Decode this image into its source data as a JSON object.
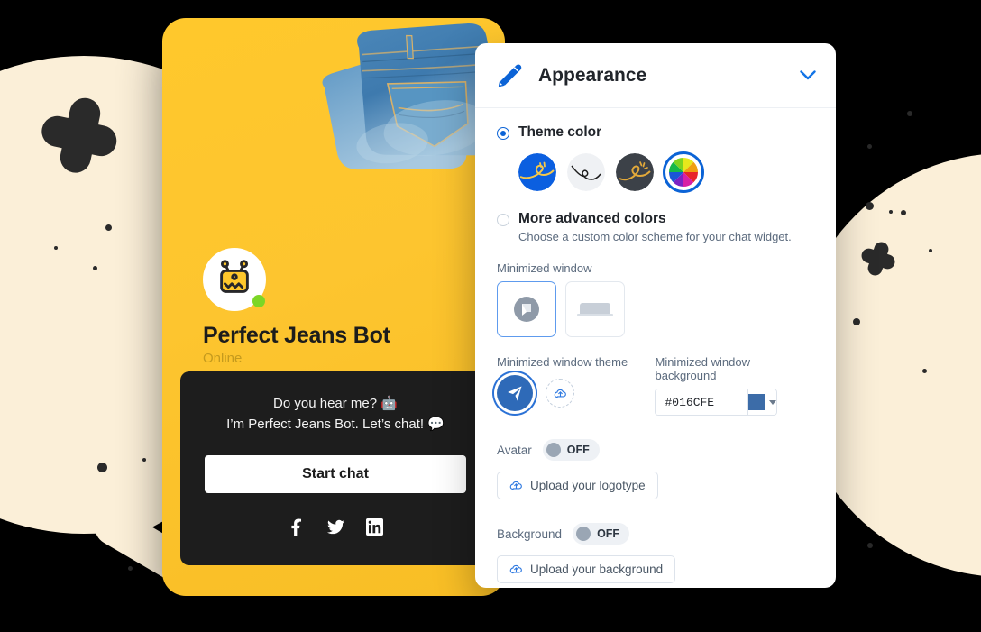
{
  "chat_widget": {
    "bot_name": "Perfect Jeans Bot",
    "status": "Online",
    "greeting_line_1": "Do you hear me? 🤖",
    "greeting_line_2": "I’m Perfect Jeans Bot. Let’s chat! 💬",
    "start_chat_label": "Start chat",
    "product_image": "folded-blue-jeans-photo",
    "avatar_icon": "robot-avatar-icon",
    "status_dot_color": "#7CD626",
    "background_color": "#FFC82C",
    "card_background": "#1D1D1D",
    "social": [
      {
        "name": "facebook-icon",
        "label": "Facebook"
      },
      {
        "name": "twitter-icon",
        "label": "Twitter"
      },
      {
        "name": "linkedin-icon",
        "label": "LinkedIn"
      }
    ]
  },
  "panel": {
    "title": "Appearance",
    "header_icon": "pencil-icon",
    "collapse_icon": "chevron-down-icon",
    "theme_color": {
      "label": "Theme color",
      "selected": true,
      "swatches": [
        {
          "name": "swatch-blue",
          "color": "#0B5FE0",
          "selected": false
        },
        {
          "name": "swatch-light",
          "color": "#EFF1F4",
          "selected": false
        },
        {
          "name": "swatch-dark",
          "color": "#3C4148",
          "selected": false
        },
        {
          "name": "swatch-rainbow",
          "color": "rainbow",
          "selected": true
        }
      ]
    },
    "advanced_colors": {
      "label": "More advanced colors",
      "selected": false,
      "description": "Choose a custom color scheme for your chat widget."
    },
    "minimized_window": {
      "label": "Minimized window",
      "options": [
        {
          "name": "minwin-bubble",
          "icon": "chat-bubble-icon",
          "selected": true
        },
        {
          "name": "minwin-bar",
          "icon": "bar-widget-icon",
          "selected": false
        }
      ]
    },
    "minimized_window_theme": {
      "label": "Minimized window theme",
      "options": [
        {
          "name": "theme-send",
          "icon": "send-plane-icon",
          "selected": true
        },
        {
          "name": "theme-upload",
          "icon": "cloud-upload-icon",
          "selected": false
        }
      ]
    },
    "minimized_window_background": {
      "label": "Minimized window background",
      "value": "#016CFE",
      "placeholder": "#016CFE",
      "swatch_color": "#3C6CA8",
      "dropdown_icon": "caret-down-icon"
    },
    "avatar": {
      "label": "Avatar",
      "state": "OFF",
      "upload_label": "Upload your logotype",
      "upload_icon": "cloud-upload-icon"
    },
    "background": {
      "label": "Background",
      "state": "OFF",
      "upload_label": "Upload your background",
      "upload_icon": "cloud-upload-icon"
    }
  },
  "decoration": {
    "page_background": "#000000",
    "blob_color": "#FBEFD8",
    "shape_color": "#2A2A2A"
  }
}
